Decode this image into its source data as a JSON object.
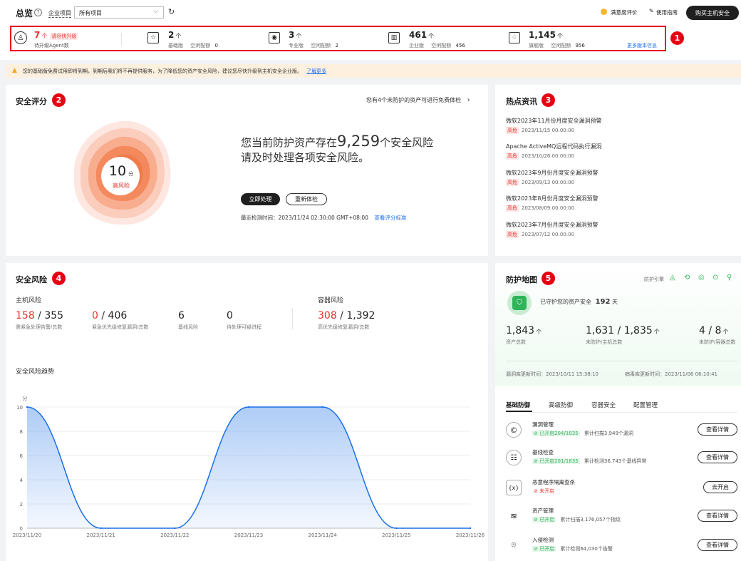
{
  "header": {
    "title": "总览",
    "help_icon": "help-circle-icon",
    "project_label": "企业项目",
    "project_select": "所有项目",
    "refresh_icon": "refresh-icon",
    "rating_label": "满意度评价",
    "guide_label": "使用指南",
    "buy_button": "购买主机安全"
  },
  "quota": {
    "agent": {
      "count": "7",
      "unit": "个",
      "tag": "请尽快升级",
      "label": "待升级Agent数"
    },
    "basic": {
      "count": "2",
      "unit": "个",
      "edition": "基础版",
      "idle_label": "空闲配额",
      "idle": "0"
    },
    "pro": {
      "count": "3",
      "unit": "个",
      "edition": "专业版",
      "idle_label": "空闲配额",
      "idle": "2"
    },
    "enterprise": {
      "count": "461",
      "unit": "个",
      "edition": "企业版",
      "idle_label": "空闲配额",
      "idle": "456"
    },
    "premium": {
      "count": "1,145",
      "unit": "个",
      "edition": "旗舰版",
      "idle_label": "空闲配额",
      "idle": "956"
    },
    "more_link": "更多版本信息"
  },
  "notice": {
    "text": "您的基础版免费试用即将到期，到期后我们将不再提供服务，为了降低您的资产安全风险，建议您尽快升级到主机安全企业版。",
    "link": "了解更多"
  },
  "callouts": [
    "1",
    "2",
    "3",
    "4",
    "5"
  ],
  "score": {
    "title": "安全评分",
    "free_check": "您有4个未防护的资产可进行免费体检",
    "value": "10",
    "unit": "分",
    "level": "高风险",
    "line1_pre": "您当前防护资产存在",
    "risk_count": "9,259",
    "line1_post": "个安全风险",
    "line2": "请及时处理各项安全风险。",
    "handle_btn": "立即处理",
    "recheck_btn": "重新体检",
    "last_check_label": "最近检测时间：",
    "last_check_time": "2023/11/24 02:30:00 GMT+08:00",
    "standard_link": "查看评分标准"
  },
  "news": {
    "title": "热点资讯",
    "items": [
      {
        "title": "微软2023年11月份月度安全漏洞预警",
        "tag": "高危",
        "date": "2023/11/15 00:00:00"
      },
      {
        "title": "Apache ActiveMQ远程代码执行漏洞",
        "tag": "高危",
        "date": "2023/10/26 00:00:00"
      },
      {
        "title": "微软2023年9月份月度安全漏洞预警",
        "tag": "高危",
        "date": "2023/09/13 00:00:00"
      },
      {
        "title": "微软2023年8月份月度安全漏洞预警",
        "tag": "高危",
        "date": "2023/08/09 00:00:00"
      },
      {
        "title": "微软2023年7月份月度安全漏洞预警",
        "tag": "高危",
        "date": "2023/07/12 00:00:00"
      }
    ]
  },
  "risk": {
    "title": "安全风险",
    "host_title": "主机风险",
    "container_title": "容器风险",
    "m1": {
      "a": "158",
      "b": "355",
      "label": "需紧急处理告警/总数"
    },
    "m2": {
      "a": "0",
      "b": "406",
      "label": "紧急优先级修复漏洞/总数"
    },
    "m3": {
      "a": "6",
      "label": "基线风险"
    },
    "m4": {
      "a": "0",
      "label": "待处理可疑进程"
    },
    "m5": {
      "a": "308",
      "b": "1,392",
      "label": "高优先级修复漏洞/总数"
    },
    "trend_title": "安全风险趋势",
    "y_unit": "分"
  },
  "chart_data": {
    "type": "area",
    "categories": [
      "2023/11/20",
      "2023/11/21",
      "2023/11/22",
      "2023/11/23",
      "2023/11/24",
      "2023/11/25",
      "2023/11/26"
    ],
    "values": [
      10,
      0,
      0,
      10,
      10,
      0,
      0
    ],
    "ylim": [
      0,
      10
    ],
    "yticks": [
      0,
      2,
      4,
      6,
      8,
      10
    ],
    "ylabel": "分",
    "grid": true,
    "color": "#1a6fe8"
  },
  "protect": {
    "title": "防护地图",
    "engine_label": "防护引擎",
    "guard_text_pre": "已守护您的资产安全",
    "guard_days": "192",
    "guard_unit": "天",
    "s1": {
      "value": "1,843",
      "unit": "个",
      "label": "资产总数"
    },
    "s2": {
      "value": "1,631 / 1,835",
      "unit": "个",
      "label": "未防护/主机总数"
    },
    "s3": {
      "value": "4 / 8",
      "unit": "个",
      "label": "未防护/容器总数"
    },
    "vuln_db": "漏洞库更新时间：2023/10/11 15:38:10",
    "virus_db": "病毒库更新时间：2023/11/06 06:10:41",
    "tabs": [
      "基础防御",
      "高级防御",
      "容器安全",
      "配置管理"
    ],
    "features": [
      {
        "name": "漏洞管理",
        "status": "已开启204/1835",
        "desc": "累计扫描3,949个漏洞",
        "btn": "查看详情",
        "icon": "vuln-icon",
        "on": true
      },
      {
        "name": "基线检查",
        "status": "已开启201/1835",
        "desc": "累计检测36,743个基线异常",
        "btn": "查看详情",
        "icon": "baseline-icon",
        "on": true
      },
      {
        "name": "恶意程序隔离查杀",
        "status": "未开启",
        "desc": "",
        "btn": "去开启",
        "icon": "malware-icon",
        "on": false
      },
      {
        "name": "资产管理",
        "status": "已开启",
        "desc": "累计扫描3,176,057个指纹",
        "btn": "查看详情",
        "icon": "asset-icon",
        "on": true
      },
      {
        "name": "入侵检测",
        "status": "已开启",
        "desc": "累计检测64,030个告警",
        "btn": "查看详情",
        "icon": "intrusion-icon",
        "on": true
      }
    ]
  }
}
